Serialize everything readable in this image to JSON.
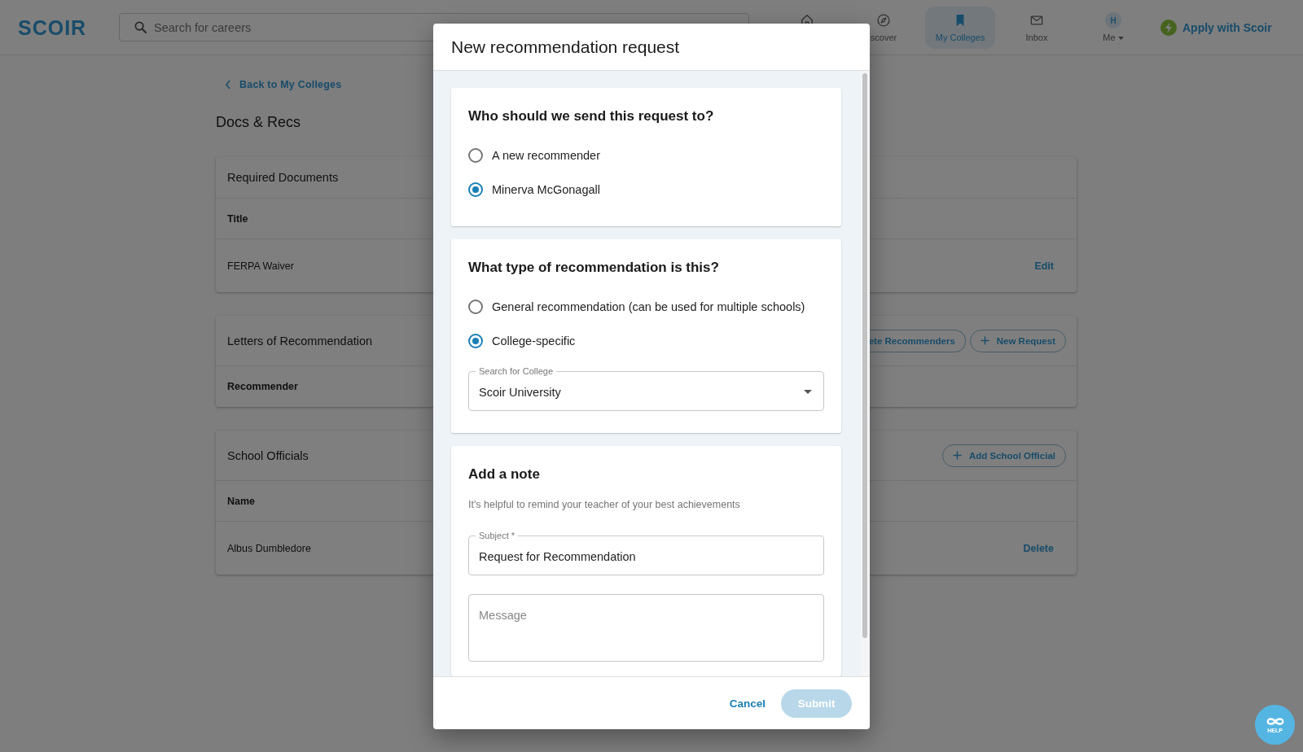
{
  "topbar": {
    "logo": "SCOIR",
    "search": {
      "placeholder": "Search for careers"
    },
    "nav": [
      {
        "kind": "home",
        "selected": false
      },
      {
        "kind": "discover",
        "label": "scover",
        "selected": false
      },
      {
        "kind": "colleges",
        "label": "My Colleges",
        "selected": true
      },
      {
        "kind": "inbox",
        "label": "Inbox",
        "selected": false
      },
      {
        "kind": "profile",
        "label": "Me",
        "avatar": "H",
        "selected": false
      }
    ],
    "apply_button": "Apply with Scoir"
  },
  "page": {
    "back_link": "Back to My Colleges",
    "title": "Docs & Recs",
    "cards": [
      {
        "title": "Required Documents",
        "column": "Title",
        "rows": [
          {
            "name": "FERPA Waiver",
            "action": "Edit"
          }
        ]
      },
      {
        "title": "Letters of Recommendation",
        "buttons": [
          {
            "kind": "cut",
            "label": "ete Recommenders"
          },
          {
            "kind": "plus",
            "label": "New Request"
          }
        ],
        "column": "Recommender"
      },
      {
        "title": "School Officials",
        "buttons": [
          {
            "kind": "plus",
            "label": "Add School Official"
          }
        ],
        "column": "Name",
        "rows": [
          {
            "name": "Albus Dumbledore",
            "action": "Delete"
          }
        ]
      }
    ]
  },
  "modal": {
    "title": "New recommendation request",
    "sections": [
      {
        "heading": "Who should we send this request to?",
        "options": [
          {
            "label": "A new recommender",
            "selected": false
          },
          {
            "label": "Minerva McGonagall",
            "selected": true
          }
        ]
      },
      {
        "heading": "What type of recommendation is this?",
        "options": [
          {
            "label": "General recommendation (can be used for multiple schools)",
            "selected": false
          },
          {
            "label": "College-specific",
            "selected": true
          }
        ],
        "select": {
          "label": "Search for College",
          "value": "Scoir University"
        }
      },
      {
        "heading": "Add a note",
        "hint": "It's helpful to remind your teacher of your best achievements",
        "fields": [
          {
            "kind": "text",
            "label": "Subject *",
            "value": "Request for Recommendation"
          },
          {
            "kind": "textarea",
            "placeholder": "Message"
          }
        ]
      }
    ],
    "buttons": {
      "cancel": "Cancel",
      "submit": {
        "label": "Submit",
        "disabled": true
      }
    }
  },
  "help_button": "HELP"
}
